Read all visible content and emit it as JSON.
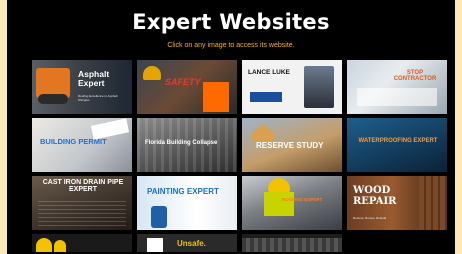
{
  "page": {
    "title": "Expert Websites",
    "subtitle": "Click on any image to access its website."
  },
  "tiles": [
    {
      "label": "Asphalt Expert",
      "tagline": "Roofing Excellence in Asphalt Shingles"
    },
    {
      "label": "SAFETY",
      "tagline": ""
    },
    {
      "label": "LANCE LUKE",
      "tagline": ""
    },
    {
      "label": "STOP CONTRACTOR",
      "tagline": ""
    },
    {
      "label": "BUILDING PERMIT",
      "tagline": ""
    },
    {
      "label": "Florida Building Collapse",
      "tagline": ""
    },
    {
      "label": "RESERVE STUDY",
      "tagline": ""
    },
    {
      "label": "WATERPROOFING EXPERT",
      "tagline": ""
    },
    {
      "label": "CAST IRON DRAIN PIPE EXPERT",
      "tagline": ""
    },
    {
      "label": "PAINTING EXPERT",
      "tagline": ""
    },
    {
      "label": "ROOFING EXPERT",
      "tagline": ""
    },
    {
      "label": "WOOD REPAIR",
      "tagline": "Restore. Renew. Rebuild"
    },
    {
      "label": "",
      "tagline": ""
    },
    {
      "label": "Unsafe.",
      "tagline": ""
    },
    {
      "label": "",
      "tagline": ""
    }
  ],
  "colors": {
    "background": "#fde9b8",
    "panel": "#000000",
    "title": "#ffffff",
    "subtitle": "#f5b400",
    "accent_blue": "#1e90ff",
    "accent_orange": "#ff7a1a"
  }
}
